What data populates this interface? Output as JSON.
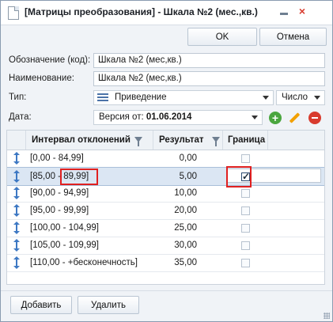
{
  "window": {
    "title": "[Матрицы преобразования] - Шкала №2 (мес.,кв.)",
    "close_symbol": "×"
  },
  "buttons": {
    "ok": "OK",
    "cancel": "Отмена",
    "add": "Добавить",
    "delete": "Удалить"
  },
  "fields": {
    "code_label": "Обозначение (код):",
    "code_value": "Шкала №2 (мес,кв.)",
    "name_label": "Наименование:",
    "name_value": "Шкала №2 (мес,кв.)",
    "type_label": "Тип:",
    "type_value": "Приведение",
    "number_type": "Число",
    "date_label": "Дата:",
    "version_prefix": "Версия от: ",
    "version_date": "01.06.2014"
  },
  "table": {
    "columns": [
      "Интервал отклонений",
      "Результат",
      "Граница"
    ],
    "rows": [
      {
        "interval": "[0,00 - 84,99]",
        "result": "0,00",
        "checked": false,
        "selected": false
      },
      {
        "interval": "[85,00 - 89,99]",
        "result": "5,00",
        "checked": true,
        "selected": true
      },
      {
        "interval": "[90,00 - 94,99]",
        "result": "10,00",
        "checked": false,
        "selected": false
      },
      {
        "interval": "[95,00 - 99,99]",
        "result": "20,00",
        "checked": false,
        "selected": false
      },
      {
        "interval": "[100,00 - 104,99]",
        "result": "25,00",
        "checked": false,
        "selected": false
      },
      {
        "interval": "[105,00 - 109,99]",
        "result": "30,00",
        "checked": false,
        "selected": false
      },
      {
        "interval": "[110,00 - +бесконечность]",
        "result": "35,00",
        "checked": false,
        "selected": false
      }
    ]
  },
  "icons": {
    "document": "document-icon",
    "filter": "filter-icon",
    "list": "list-icon",
    "add": "add-icon",
    "edit": "edit-icon",
    "delete": "delete-icon",
    "move": "move-vertical-icon"
  },
  "colors": {
    "accent": "#3d78c3",
    "selection": "#dbe6f3",
    "highlight": "#e02020",
    "add": "#4aa63f",
    "delete": "#d83b2e",
    "edit": "#f2a000"
  }
}
